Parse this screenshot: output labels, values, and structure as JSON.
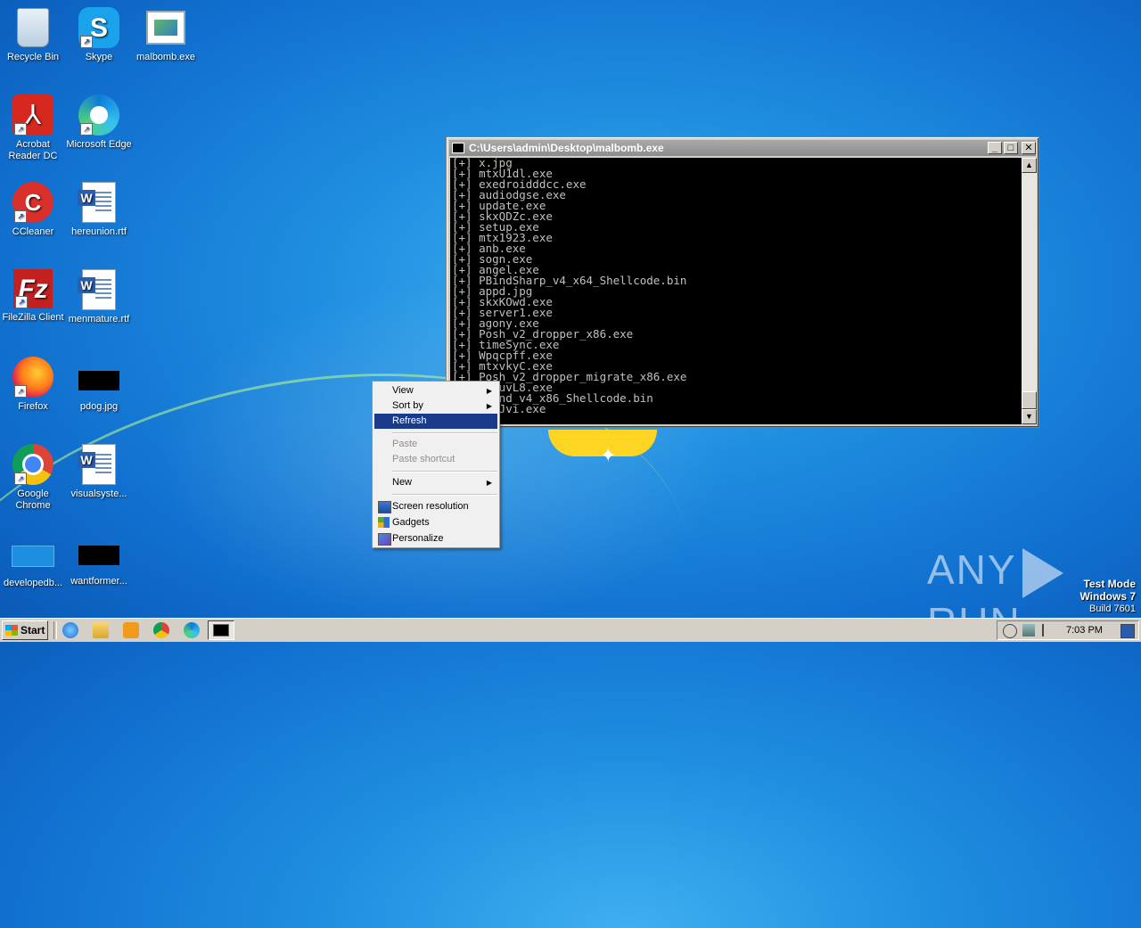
{
  "desktop": {
    "icons": [
      {
        "label": "Recycle Bin",
        "icon": "recycle-bin-icon"
      },
      {
        "label": "Skype",
        "icon": "skype-icon"
      },
      {
        "label": "malbomb.exe",
        "icon": "exe-icon"
      },
      {
        "label": "Acrobat Reader DC",
        "icon": "acrobat-icon"
      },
      {
        "label": "Microsoft Edge",
        "icon": "edge-icon"
      },
      {
        "label": "CCleaner",
        "icon": "ccleaner-icon"
      },
      {
        "label": "hereunion.rtf",
        "icon": "word-doc-icon"
      },
      {
        "label": "FileZilla Client",
        "icon": "filezilla-icon"
      },
      {
        "label": "menmature.rtf",
        "icon": "word-doc-icon"
      },
      {
        "label": "Firefox",
        "icon": "firefox-icon"
      },
      {
        "label": "pdog.jpg",
        "icon": "image-thumbnail-icon"
      },
      {
        "label": "Google Chrome",
        "icon": "chrome-icon"
      },
      {
        "label": "visualsyste...",
        "icon": "word-doc-icon"
      },
      {
        "label": "developedb...",
        "icon": "image-thumbnail-icon"
      },
      {
        "label": "wantformer...",
        "icon": "image-thumbnail-icon"
      }
    ]
  },
  "console": {
    "title": "C:\\Users\\admin\\Desktop\\malbomb.exe",
    "lines": [
      "[+] x.jpg",
      "[+] mtxU1dl.exe",
      "[+] exedroidddcc.exe",
      "[+] audiodgse.exe",
      "[+] update.exe",
      "[+] skxQDZc.exe",
      "[+] setup.exe",
      "[+] mtx1923.exe",
      "[+] anb.exe",
      "[+] sogn.exe",
      "[+] angel.exe",
      "[+] PBindSharp_v4_x64_Shellcode.bin",
      "[+] appd.jpg",
      "[+] skxKOwd.exe",
      "[+] server1.exe",
      "[+] agony.exe",
      "[+] Posh_v2_dropper_x86.exe",
      "[+] timeSync.exe",
      "[+] Wpqcpff.exe",
      "[+] mtxvkyC.exe",
      "[+] Posh_v2_dropper_migrate_x86.exe",
      "[+] mtxuvL8.exe",
      "[+] PBind_v4_x86_Shellcode.bin",
      "[+] tb5Jvi.exe"
    ]
  },
  "context_menu": {
    "items": [
      {
        "label": "View",
        "submenu": true,
        "enabled": true
      },
      {
        "label": "Sort by",
        "submenu": true,
        "enabled": true
      },
      {
        "label": "Refresh",
        "submenu": false,
        "enabled": true,
        "selected": true
      },
      {
        "label": "Paste",
        "submenu": false,
        "enabled": false
      },
      {
        "label": "Paste shortcut",
        "submenu": false,
        "enabled": false
      },
      {
        "label": "New",
        "submenu": true,
        "enabled": true
      },
      {
        "label": "Screen resolution",
        "submenu": false,
        "enabled": true,
        "icon": "screen-resolution-icon"
      },
      {
        "label": "Gadgets",
        "submenu": false,
        "enabled": true,
        "icon": "gadgets-icon"
      },
      {
        "label": "Personalize",
        "submenu": false,
        "enabled": true,
        "icon": "personalize-icon"
      }
    ]
  },
  "watermark": {
    "brand_left": "ANY",
    "brand_right": "RUN",
    "test_mode": "Test Mode",
    "os_name": "Windows 7",
    "build": "Build 7601"
  },
  "taskbar": {
    "start_label": "Start",
    "clock": "7:03 PM",
    "pinned": [
      "internet-explorer-icon",
      "file-explorer-icon",
      "media-player-icon",
      "chrome-icon",
      "edge-icon"
    ],
    "active_task": "console-task-icon"
  },
  "colors": {
    "desktop_blue": "#1f8ee0",
    "menu_highlight": "#1a3a8c",
    "console_bg": "#000000",
    "console_text": "#c0c0c0"
  }
}
